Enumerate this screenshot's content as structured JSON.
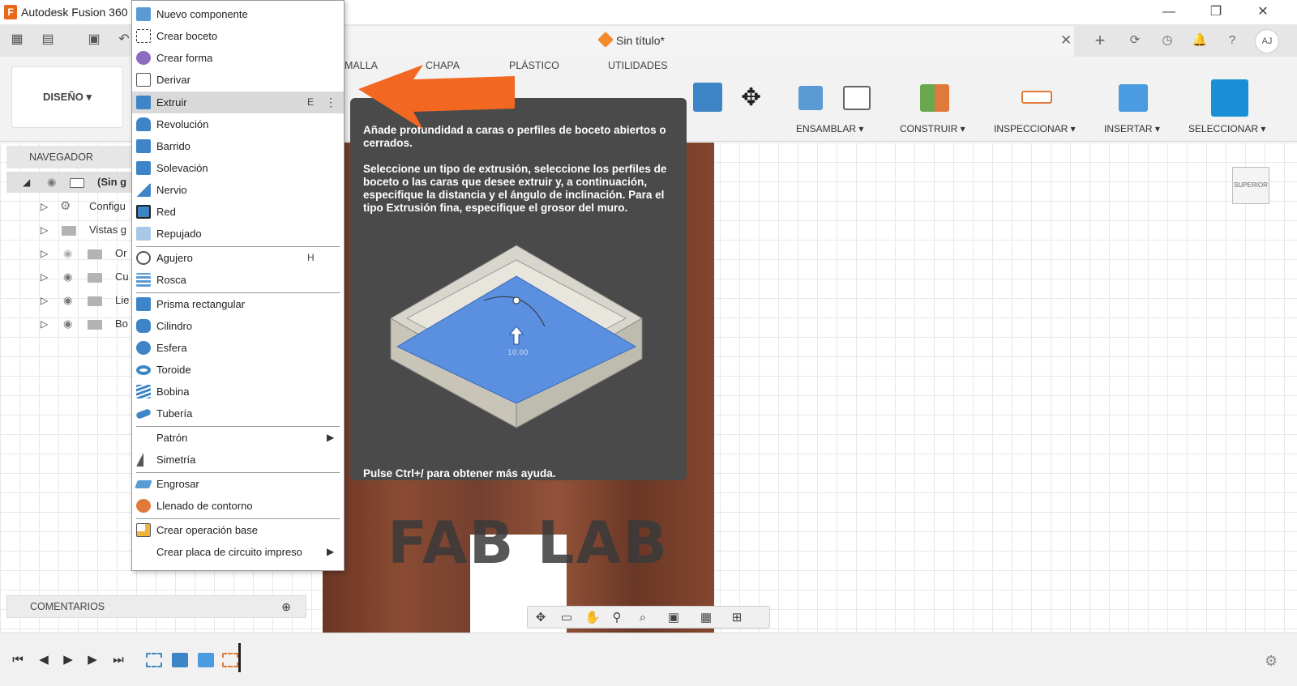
{
  "window": {
    "app_title": "Autodesk Fusion 360",
    "minimize": "—",
    "restore": "❐",
    "close": "✕"
  },
  "quick_access": {
    "doc_title": "Sin título*",
    "doc_close": "✕",
    "user_initials": "AJ"
  },
  "ribbon": {
    "workspace": "DISEÑO ▾",
    "tabs": [
      "MALLA",
      "CHAPA",
      "PLÁSTICO",
      "UTILIDADES"
    ],
    "groups": [
      "ENSAMBLAR ▾",
      "CONSTRUIR ▾",
      "INSPECCIONAR ▾",
      "INSERTAR ▾",
      "SELECCIONAR ▾"
    ]
  },
  "navigator": {
    "header": "NAVEGADOR",
    "rows": [
      {
        "label": "(Sin g"
      },
      {
        "label": "Configu"
      },
      {
        "label": "Vistas g"
      },
      {
        "label": "Or"
      },
      {
        "label": "Cu"
      },
      {
        "label": "Lie"
      },
      {
        "label": "Bo"
      }
    ]
  },
  "comments": {
    "label": "COMENTARIOS",
    "add": "⊕"
  },
  "canvas": {
    "watermark": "FAB LAB",
    "viewcube": "SUPERIOR"
  },
  "menu": {
    "items": [
      {
        "label": "Nuevo componente",
        "color": "#5b9bd5"
      },
      {
        "label": "Crear boceto",
        "color": "#6aa84f"
      },
      {
        "label": "Crear forma",
        "color": "#8e6bbf"
      },
      {
        "label": "Derivar",
        "color": "#777777"
      },
      {
        "label": "Extruir",
        "shortcut": "E",
        "more": "⋮",
        "color": "#3d85c6"
      },
      {
        "label": "Revolución",
        "color": "#3d85c6"
      },
      {
        "label": "Barrido",
        "color": "#3d85c6"
      },
      {
        "label": "Solevación",
        "color": "#3d85c6"
      },
      {
        "label": "Nervio",
        "color": "#3d85c6"
      },
      {
        "label": "Red",
        "color": "#3d85c6"
      },
      {
        "label": "Repujado",
        "color": "#3d85c6"
      },
      {
        "label": "Agujero",
        "shortcut": "H",
        "color": "#5b5b5b"
      },
      {
        "label": "Rosca",
        "color": "#5b9bd5"
      },
      {
        "label": "Prisma rectangular",
        "color": "#3d85c6"
      },
      {
        "label": "Cilindro",
        "color": "#3d85c6"
      },
      {
        "label": "Esfera",
        "color": "#3d85c6"
      },
      {
        "label": "Toroide",
        "color": "#3d85c6"
      },
      {
        "label": "Bobina",
        "color": "#3d85c6"
      },
      {
        "label": "Tubería",
        "color": "#3d85c6"
      },
      {
        "label": "Patrón",
        "arrow": "▶"
      },
      {
        "label": "Simetría",
        "color": "#555555"
      },
      {
        "label": "Engrosar",
        "color": "#5b9bd5"
      },
      {
        "label": "Llenado de contorno",
        "color": "#e07a3a"
      },
      {
        "label": "Crear operación base",
        "color": "#f0b43c"
      },
      {
        "label": "Crear placa de circuito impreso",
        "arrow": "▶"
      }
    ]
  },
  "tooltip": {
    "p1": "Añade profundidad a caras o perfiles de boceto abiertos o cerrados.",
    "p2": "Seleccione un tipo de extrusión, seleccione los perfiles de boceto o las caras que desee extruir y, a continuación, especifique la distancia y el ángulo de inclinación. Para el tipo Extrusión fina, especifique el grosor del muro.",
    "illus_dim": "10.00",
    "footer": "Pulse Ctrl+/ para obtener más ayuda."
  },
  "colors": {
    "accent": "#e8681c",
    "arrow": "#f26722"
  }
}
